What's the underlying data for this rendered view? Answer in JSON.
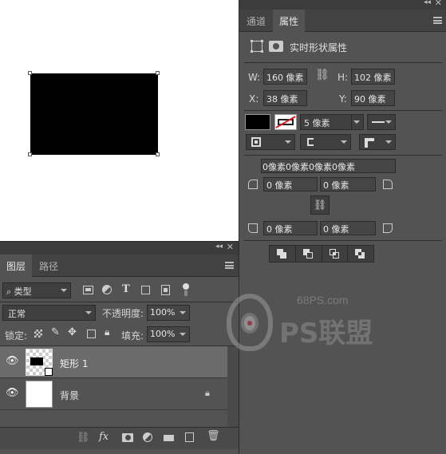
{
  "properties": {
    "tabs": [
      {
        "label": "通道"
      },
      {
        "label": "属性"
      }
    ],
    "header": "实时形状属性",
    "w_label": "W:",
    "w_value": "160 像素",
    "h_label": "H:",
    "h_value": "102 像素",
    "x_label": "X:",
    "x_value": "38 像素",
    "y_label": "Y:",
    "y_value": "90 像素",
    "stroke_width": "5 像素",
    "corner_all": "0像素0像素0像素0像素",
    "corner_tl": "0 像素",
    "corner_tr": "0 像素",
    "corner_bl": "0 像素",
    "corner_br": "0 像素"
  },
  "layers_panel": {
    "tabs": [
      {
        "label": "图层"
      },
      {
        "label": "路径"
      }
    ],
    "filter_label": "类型",
    "blend_mode": "正常",
    "opacity_label": "不透明度:",
    "opacity_value": "100%",
    "lock_label": "锁定:",
    "fill_label": "填充:",
    "fill_value": "100%",
    "layers": [
      {
        "name": "矩形 1",
        "selected": true
      },
      {
        "name": "背景",
        "selected": false
      }
    ]
  },
  "watermark": {
    "domain": "68PS.com",
    "brand": "PS联盟"
  },
  "colors": {
    "panel": "#535353",
    "canvas": "#ffffff",
    "shape_fill": "#000000",
    "selected_layer": "#6b6b6b"
  }
}
